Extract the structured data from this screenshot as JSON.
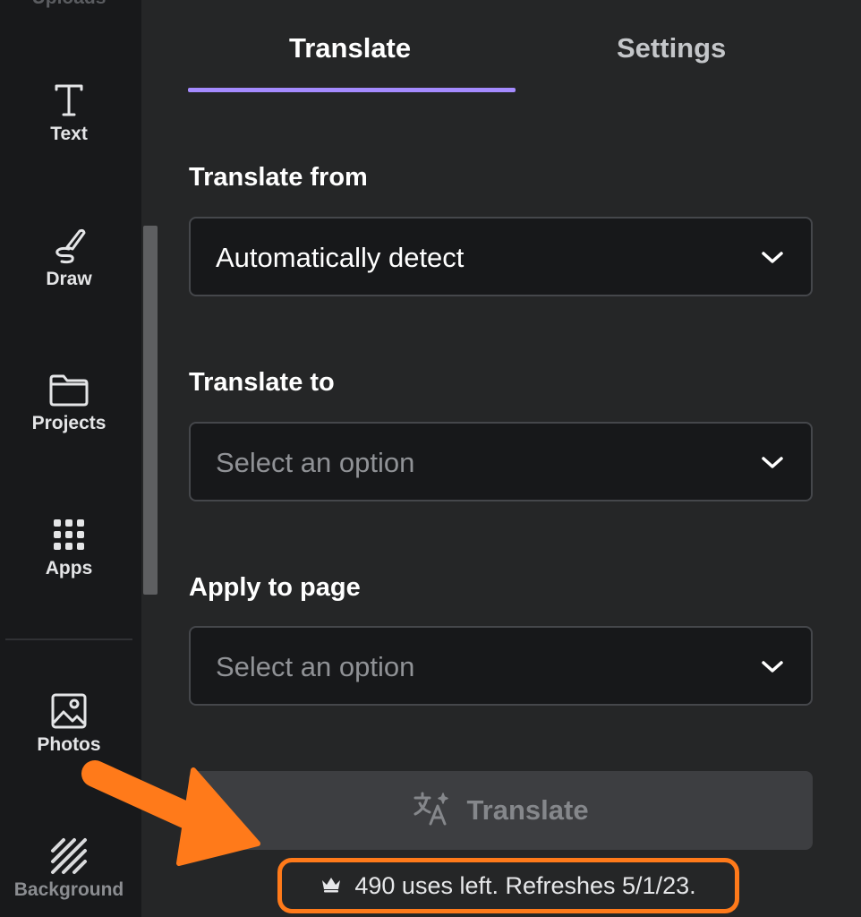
{
  "sidebar": {
    "cut_item_label": "Uploads",
    "items": [
      {
        "label": "Text",
        "icon": "text-icon"
      },
      {
        "label": "Draw",
        "icon": "draw-icon"
      },
      {
        "label": "Projects",
        "icon": "folder-icon"
      },
      {
        "label": "Apps",
        "icon": "apps-grid-icon"
      },
      {
        "label": "Photos",
        "icon": "photo-icon"
      },
      {
        "label": "Background",
        "icon": "background-hatch-icon"
      }
    ]
  },
  "tabs": [
    {
      "label": "Translate",
      "active": true
    },
    {
      "label": "Settings",
      "active": false
    }
  ],
  "form": {
    "from_label": "Translate from",
    "from_value": "Automatically detect",
    "to_label": "Translate to",
    "to_placeholder": "Select an option",
    "page_label": "Apply to page",
    "page_placeholder": "Select an option"
  },
  "translate_button": {
    "label": "Translate",
    "icon": "translate-sparkle-icon",
    "disabled": true
  },
  "usage": {
    "icon": "crown-icon",
    "text": "490 uses left. Refreshes 5/1/23."
  },
  "colors": {
    "accent_tab": "#a58bff",
    "highlight_orange": "#ff7a1a"
  }
}
